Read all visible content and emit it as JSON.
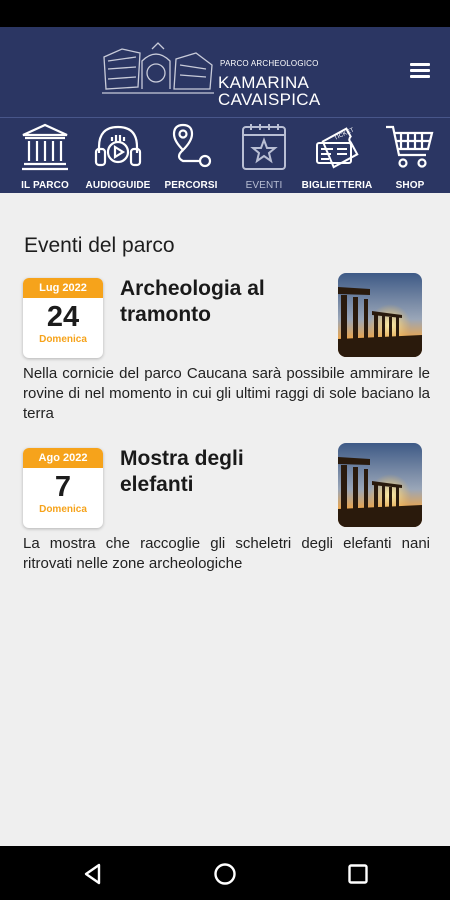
{
  "header": {
    "logo_small": "PARCO ARCHEOLOGICO",
    "logo_line1": "KAMARINA",
    "logo_line2": "CAVAISPICA",
    "menu_icon": "hamburger-menu-icon",
    "bg_color": "#2b3663"
  },
  "nav": {
    "items": [
      {
        "label": "IL PARCO",
        "icon": "temple-icon",
        "active": false
      },
      {
        "label": "AUDIOGUIDE",
        "icon": "headphones-icon",
        "active": false
      },
      {
        "label": "PERCORSI",
        "icon": "route-pin-icon",
        "active": false
      },
      {
        "label": "EVENTI",
        "icon": "calendar-star-icon",
        "active": true
      },
      {
        "label": "BIGLIETTERIA",
        "icon": "ticket-icon",
        "active": false
      },
      {
        "label": "SHOP",
        "icon": "shopping-cart-icon",
        "active": false
      }
    ]
  },
  "main": {
    "section_title": "Eventi del parco",
    "events": [
      {
        "month": "Lug 2022",
        "day": "24",
        "weekday": "Domenica",
        "title": "Archeologia al tramonto",
        "description": "Nella cornicie del parco Caucana sarà possibile ammirare le rovine di nel momento in cui gli ultimi raggi di sole baciano la terra"
      },
      {
        "month": "Ago 2022",
        "day": "7",
        "weekday": "Domenica",
        "title": "Mostra degli elefanti",
        "description": "La mostra che raccoglie gli scheletri degli elefanti nani ritrovati nelle zone archeologiche"
      }
    ]
  },
  "colors": {
    "accent": "#f6a31b",
    "nav_bg": "#2b3663",
    "page_bg": "#efefef"
  },
  "system_nav": {
    "icons": [
      "back-icon",
      "home-icon",
      "recents-icon"
    ]
  }
}
